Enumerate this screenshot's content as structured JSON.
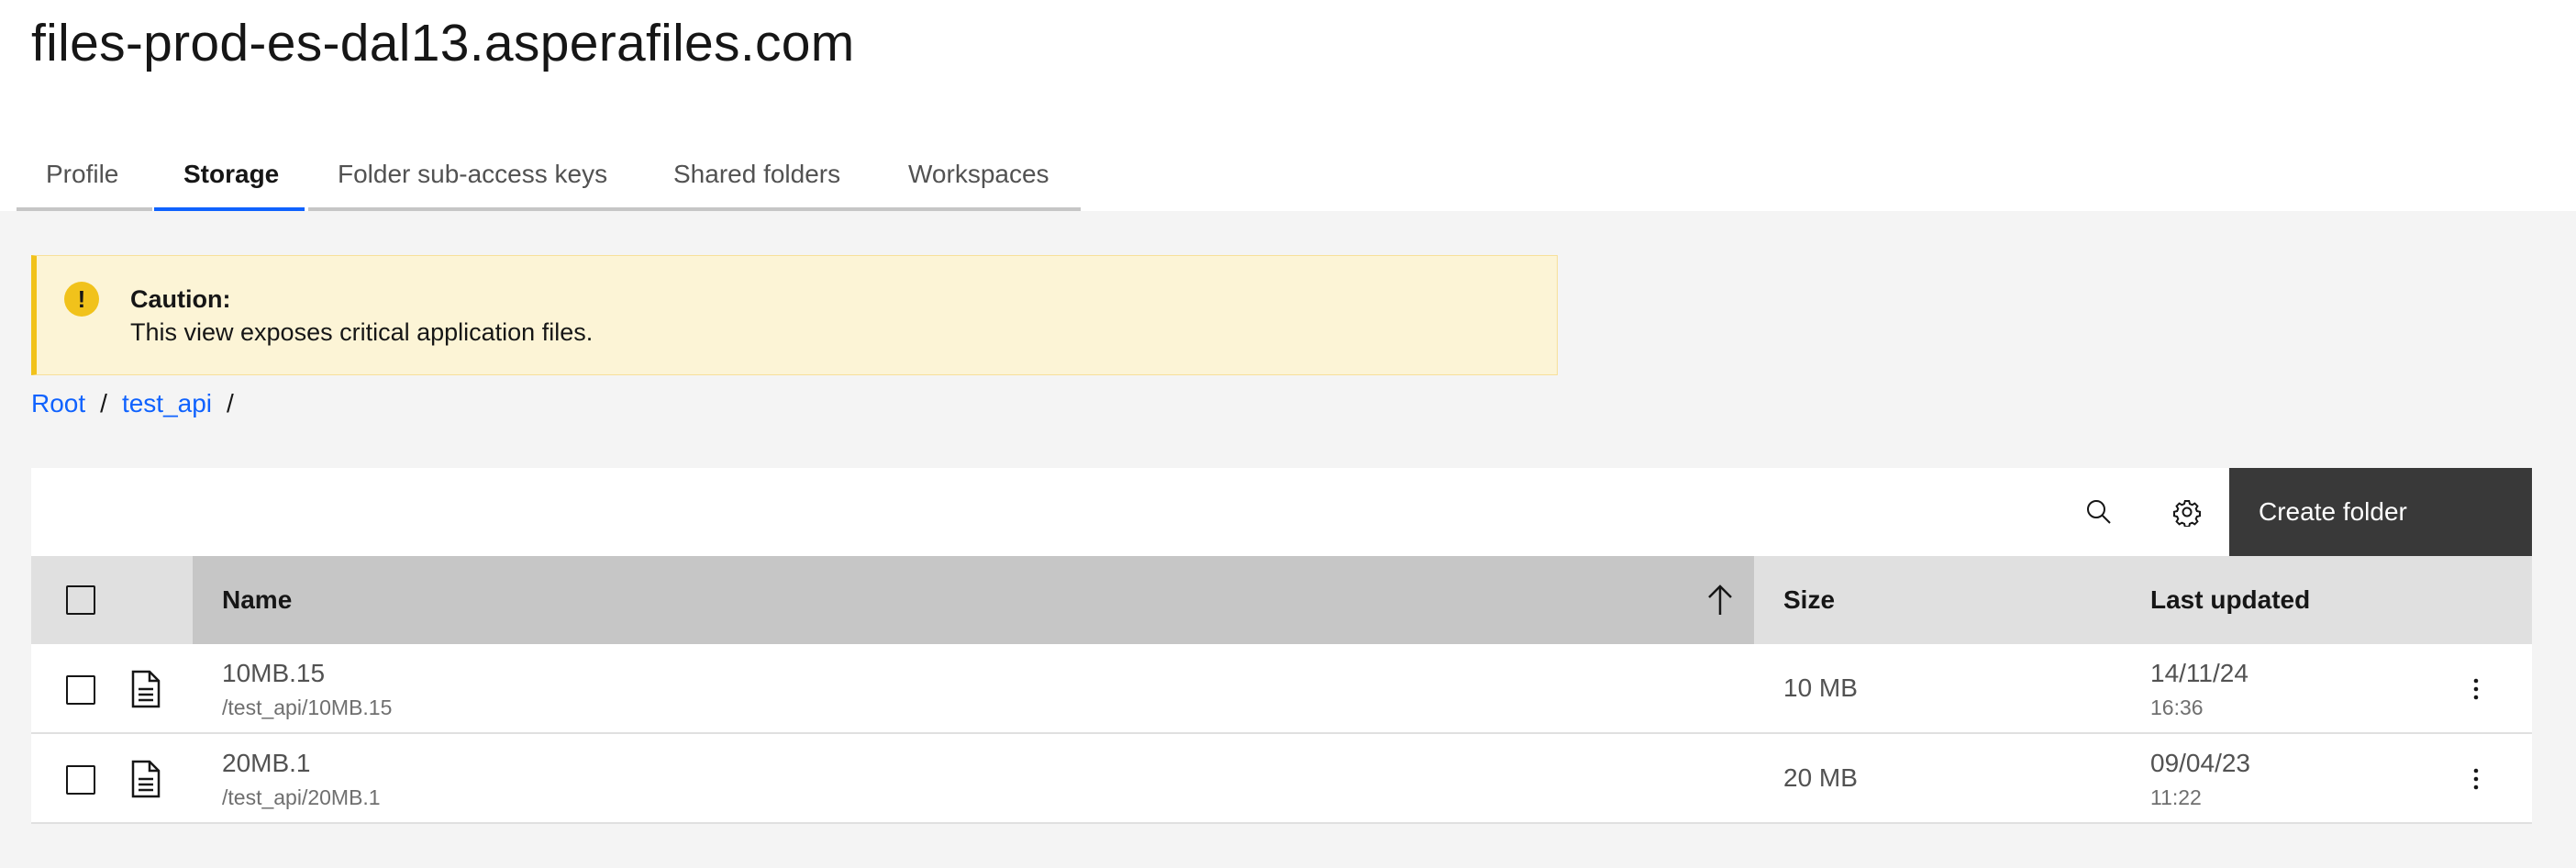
{
  "page": {
    "title": "files-prod-es-dal13.asperafiles.com"
  },
  "tabs": [
    {
      "label": "Profile",
      "active": false
    },
    {
      "label": "Storage",
      "active": true
    },
    {
      "label": "Folder sub-access keys",
      "active": false
    },
    {
      "label": "Shared folders",
      "active": false
    },
    {
      "label": "Workspaces",
      "active": false
    }
  ],
  "notification": {
    "kind": "warning",
    "icon": "warning-icon",
    "title": "Caution:",
    "subtitle": "This view exposes critical application files."
  },
  "breadcrumb": {
    "items": [
      "Root",
      "test_api"
    ],
    "separator": "/"
  },
  "toolbar": {
    "search_icon": "search-icon",
    "settings_icon": "gear-icon",
    "create_label": "Create folder"
  },
  "table": {
    "headers": {
      "name": "Name",
      "size": "Size",
      "updated": "Last updated"
    },
    "sort": {
      "column": "name",
      "direction": "ascending"
    },
    "rows": [
      {
        "name": "10MB.15",
        "path": "/test_api/10MB.15",
        "size": "10 MB",
        "date": "14/11/24",
        "time": "16:36",
        "icon": "document-icon"
      },
      {
        "name": "20MB.1",
        "path": "/test_api/20MB.1",
        "size": "20 MB",
        "date": "09/04/23",
        "time": "11:22",
        "icon": "document-icon"
      }
    ]
  },
  "colors": {
    "accent": "#0f62fe",
    "warning": "#f1c21b",
    "warning_bg": "#fcf4d6",
    "button_dark": "#393939"
  }
}
